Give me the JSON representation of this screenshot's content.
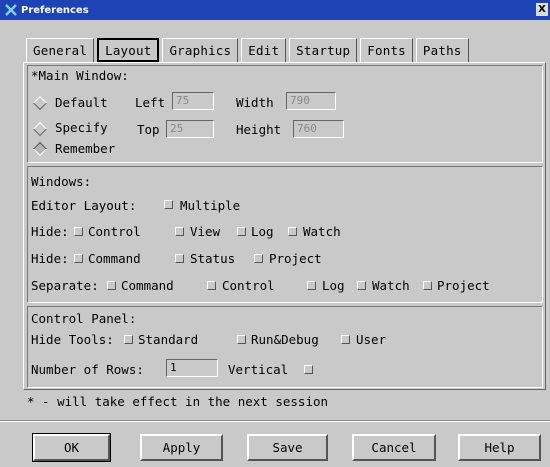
{
  "window": {
    "title": "Preferences",
    "close_glyph": "X"
  },
  "tabs": [
    {
      "label": "General"
    },
    {
      "label": "Layout",
      "active": true
    },
    {
      "label": "Graphics"
    },
    {
      "label": "Edit"
    },
    {
      "label": "Startup"
    },
    {
      "label": "Fonts"
    },
    {
      "label": "Paths"
    }
  ],
  "main_window": {
    "heading": "*Main Window:",
    "options": {
      "default": "Default",
      "specify": "Specify",
      "remember": "Remember"
    },
    "selected": "remember",
    "left_label": "Left",
    "left_value": "75",
    "top_label": "Top",
    "top_value": "25",
    "width_label": "Width",
    "width_value": "790",
    "height_label": "Height",
    "height_value": "760"
  },
  "windows": {
    "heading": "Windows:",
    "editor_layout_label": "Editor Layout:",
    "multiple_label": "Multiple",
    "hide1_label": "Hide:",
    "hide1_items": [
      "Control",
      "View",
      "Log",
      "Watch"
    ],
    "hide2_label": "Hide:",
    "hide2_items": [
      "Command",
      "Status",
      "Project"
    ],
    "separate_label": "Separate:",
    "separate_items": [
      "Command",
      "Control",
      "Log",
      "Watch",
      "Project"
    ]
  },
  "control_panel": {
    "heading": "Control Panel:",
    "hide_tools_label": "Hide Tools:",
    "hide_tools_items": [
      "Standard",
      "Run&Debug",
      "User"
    ],
    "rows_label": "Number of Rows:",
    "rows_value": "1",
    "vertical_label": "Vertical"
  },
  "footnote": "* - will take effect in the next session",
  "buttons": {
    "ok": "OK",
    "apply": "Apply",
    "save": "Save",
    "cancel": "Cancel",
    "help": "Help"
  },
  "colors": {
    "title_bar": "#1e43b7",
    "background": "#c9c9c9"
  }
}
